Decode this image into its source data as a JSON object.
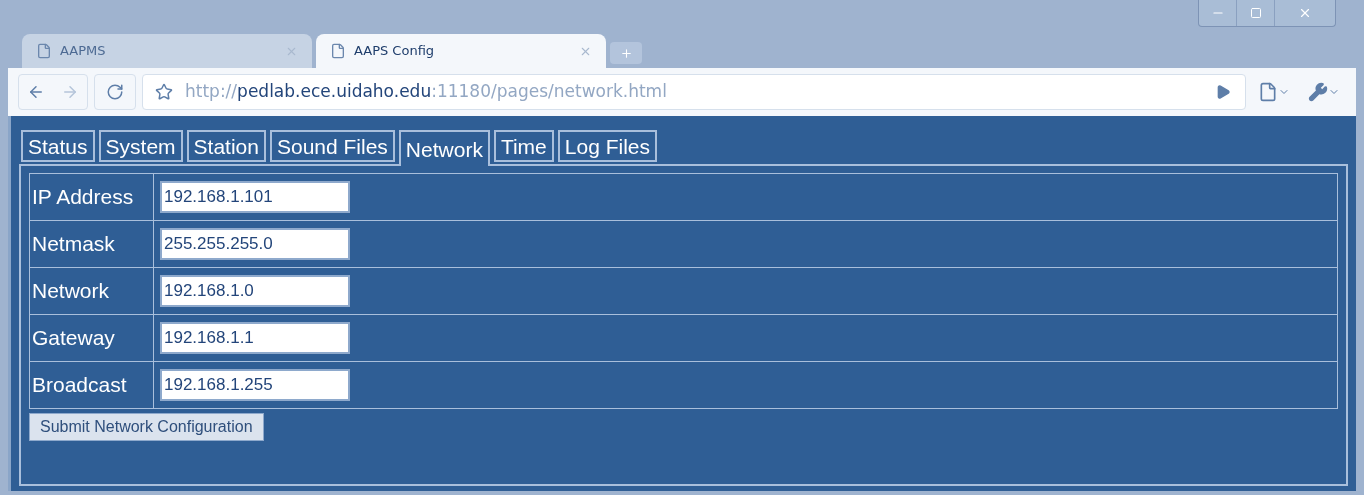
{
  "browser_tabs": [
    {
      "title": "AAPMS",
      "selected": false
    },
    {
      "title": "AAPS Config",
      "selected": true
    }
  ],
  "address": {
    "parts": [
      {
        "text": "http://",
        "kind": "dim"
      },
      {
        "text": "pedlab.ece.uidaho.edu",
        "kind": "host"
      },
      {
        "text": ":11180/pages/network.html",
        "kind": "dim"
      }
    ]
  },
  "page_tabs": [
    {
      "label": "Status",
      "selected": false
    },
    {
      "label": "System",
      "selected": false
    },
    {
      "label": "Station",
      "selected": false
    },
    {
      "label": "Sound Files",
      "selected": false
    },
    {
      "label": "Network",
      "selected": true
    },
    {
      "label": "Time",
      "selected": false
    },
    {
      "label": "Log Files",
      "selected": false
    }
  ],
  "fields": [
    {
      "label": "IP Address",
      "value": "192.168.1.101"
    },
    {
      "label": "Netmask",
      "value": "255.255.255.0"
    },
    {
      "label": "Network",
      "value": "192.168.1.0"
    },
    {
      "label": "Gateway",
      "value": "192.168.1.1"
    },
    {
      "label": "Broadcast",
      "value": "192.168.1.255"
    }
  ],
  "submit_button": "Submit Network Configuration"
}
